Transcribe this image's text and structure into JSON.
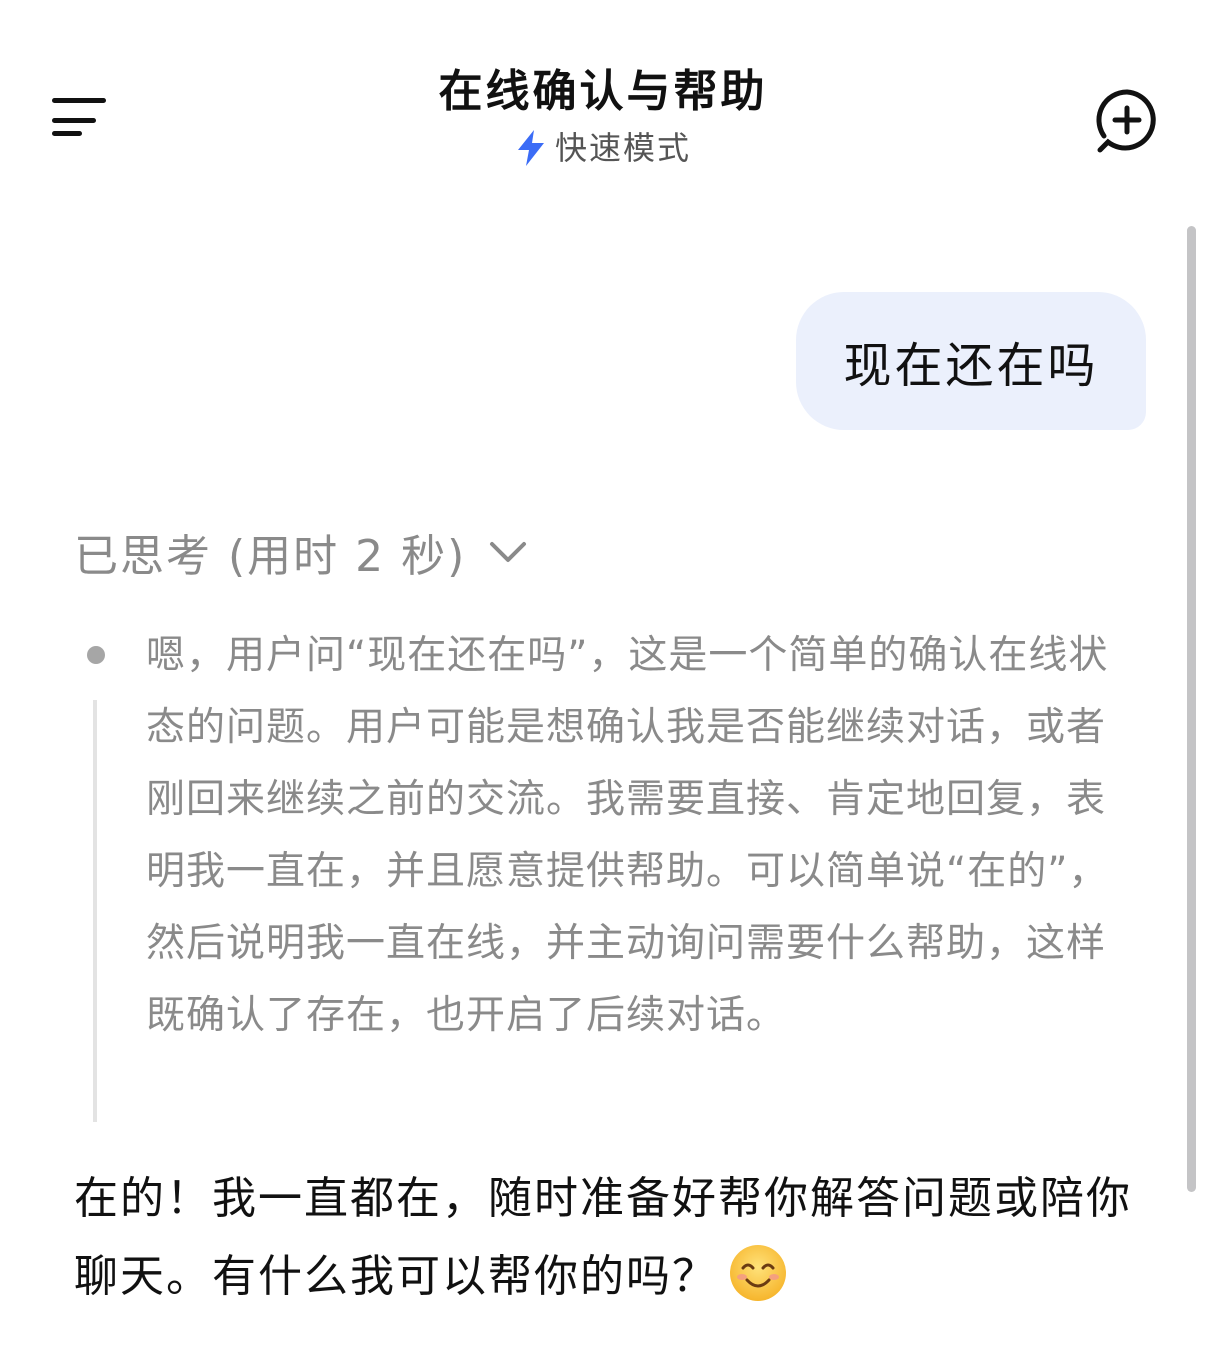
{
  "header": {
    "title": "在线确认与帮助",
    "mode_label": "快速模式",
    "mode_icon": "lightning-icon",
    "menu_icon": "menu-icon",
    "new_chat_icon": "new-chat-icon"
  },
  "colors": {
    "accent_blue": "#3b6cf6",
    "user_bubble": "#ebf0fc",
    "muted_text": "#8a8a8a",
    "body_text": "#111111"
  },
  "conversation": {
    "user_message": "现在还在吗",
    "thinking": {
      "label": "已思考 (用时 2 秒)",
      "expanded": true,
      "text": "嗯，用户问“现在还在吗”，这是一个简单的确认在线状态的问题。用户可能是想确认我是否能继续对话，或者刚回来继续之前的交流。我需要直接、肯定地回复，表明我一直在，并且愿意提供帮助。可以简单说“在的”，然后说明我一直在线，并主动询问需要什么帮助，这样既确认了存在，也开启了后续对话。"
    },
    "assistant_reply": "在的！我一直都在，随时准备好帮你解答问题或陪你聊天。有什么我可以帮你的吗？",
    "reply_emoji": "smiling-face-emoji"
  }
}
